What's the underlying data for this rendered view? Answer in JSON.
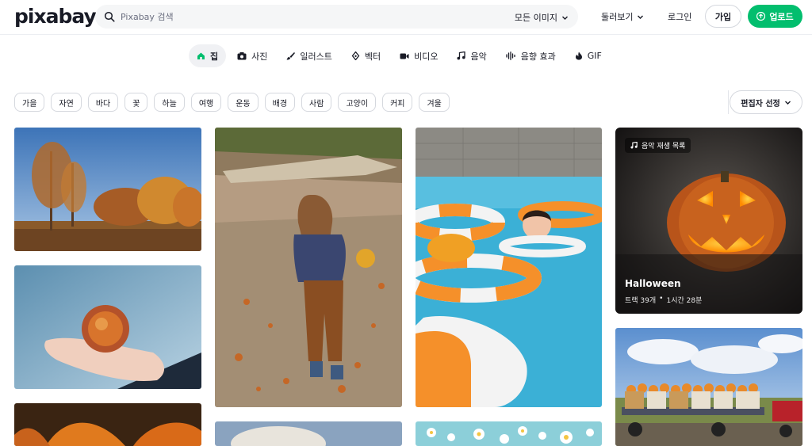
{
  "header": {
    "logo": "pixabay",
    "search_placeholder": "Pixabay 검색",
    "search_filter": "모든 이미지",
    "explore": "둘러보기",
    "login": "로그인",
    "signup": "가입",
    "upload": "업로드"
  },
  "tabs": [
    {
      "label": "집",
      "icon": "home-icon",
      "active": true
    },
    {
      "label": "사진",
      "icon": "camera-icon"
    },
    {
      "label": "일러스트",
      "icon": "brush-icon"
    },
    {
      "label": "벡터",
      "icon": "pen-nib-icon"
    },
    {
      "label": "비디오",
      "icon": "video-icon"
    },
    {
      "label": "음악",
      "icon": "music-note-icon"
    },
    {
      "label": "음향 효과",
      "icon": "waveform-icon"
    },
    {
      "label": "GIF",
      "icon": "flame-icon"
    }
  ],
  "chips": [
    "가을",
    "자연",
    "바다",
    "꽃",
    "하늘",
    "여행",
    "운동",
    "배경",
    "사람",
    "고양이",
    "커피",
    "겨울"
  ],
  "sort_label": "편집자 선정",
  "playlist": {
    "label": "음악 재생 목록",
    "title": "Halloween",
    "tracks": "트랙 39개",
    "separator": "•",
    "duration": "1시간 28분"
  },
  "colors": {
    "accent_green": "#02be6e",
    "text": "#191b26"
  }
}
